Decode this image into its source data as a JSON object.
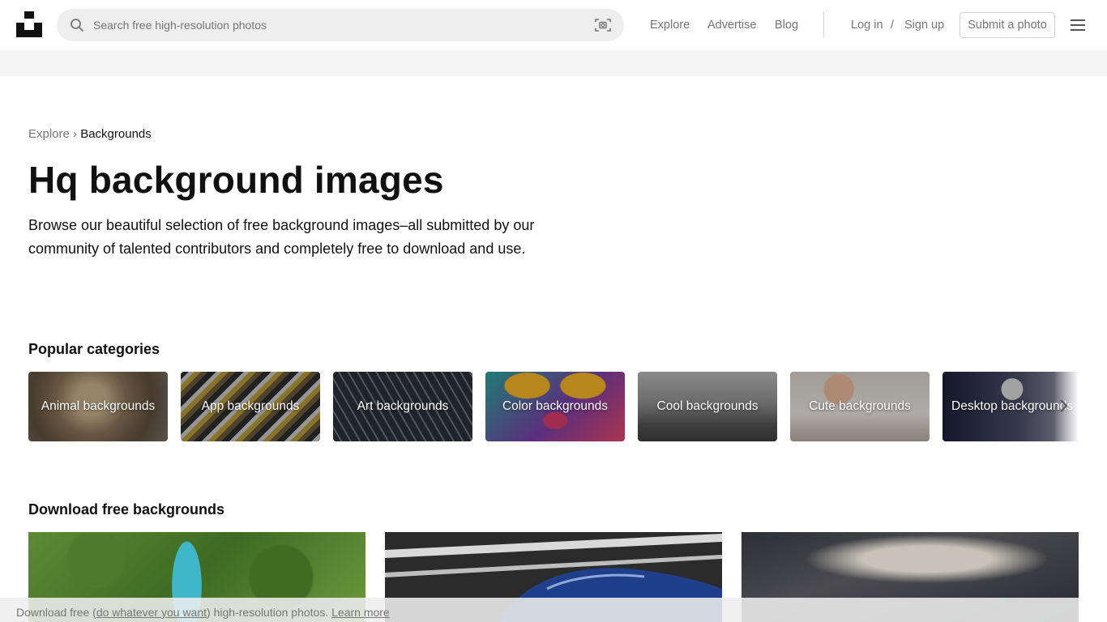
{
  "header": {
    "search_placeholder": "Search free high-resolution photos",
    "nav": {
      "explore": "Explore",
      "advertise": "Advertise",
      "blog": "Blog"
    },
    "login": "Log in",
    "separator": "/",
    "signup": "Sign up",
    "submit": "Submit a photo"
  },
  "breadcrumb": {
    "parent": "Explore",
    "separator": "›",
    "current": "Backgrounds"
  },
  "hero": {
    "title": "Hq background images",
    "description": "Browse our beautiful selection of free background images–all submitted by our community of talented contributors and completely free to download and use."
  },
  "popular": {
    "heading": "Popular categories",
    "categories": [
      {
        "label": "Animal backgrounds"
      },
      {
        "label": "App backgrounds"
      },
      {
        "label": "Art backgrounds"
      },
      {
        "label": "Color backgrounds"
      },
      {
        "label": "Cool backgrounds"
      },
      {
        "label": "Cute backgrounds"
      },
      {
        "label": "Desktop backgrounds"
      }
    ]
  },
  "download": {
    "heading": "Download free backgrounds"
  },
  "banner": {
    "text_before": "Download free (",
    "link_license": "do whatever you want",
    "text_after": ") high-resolution photos.",
    "link_learn": "Learn more"
  },
  "colors": {
    "text": "#111111",
    "muted": "#767676",
    "search_bg": "#eeeeee",
    "band_bg": "#f5f5f5"
  },
  "icons": [
    "unsplash-logo",
    "search-icon",
    "visual-search-icon",
    "menu-icon",
    "chevron-right-icon"
  ]
}
